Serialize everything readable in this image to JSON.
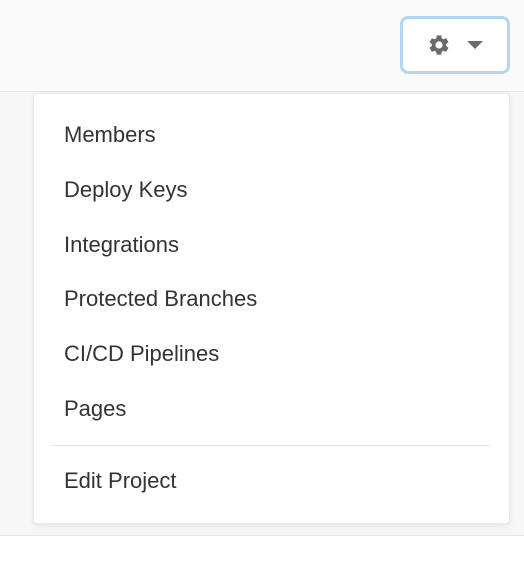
{
  "settings_menu": {
    "items": [
      {
        "label": "Members"
      },
      {
        "label": "Deploy Keys"
      },
      {
        "label": "Integrations"
      },
      {
        "label": "Protected Branches"
      },
      {
        "label": "CI/CD Pipelines"
      },
      {
        "label": "Pages"
      }
    ],
    "footer_item": {
      "label": "Edit Project"
    }
  }
}
